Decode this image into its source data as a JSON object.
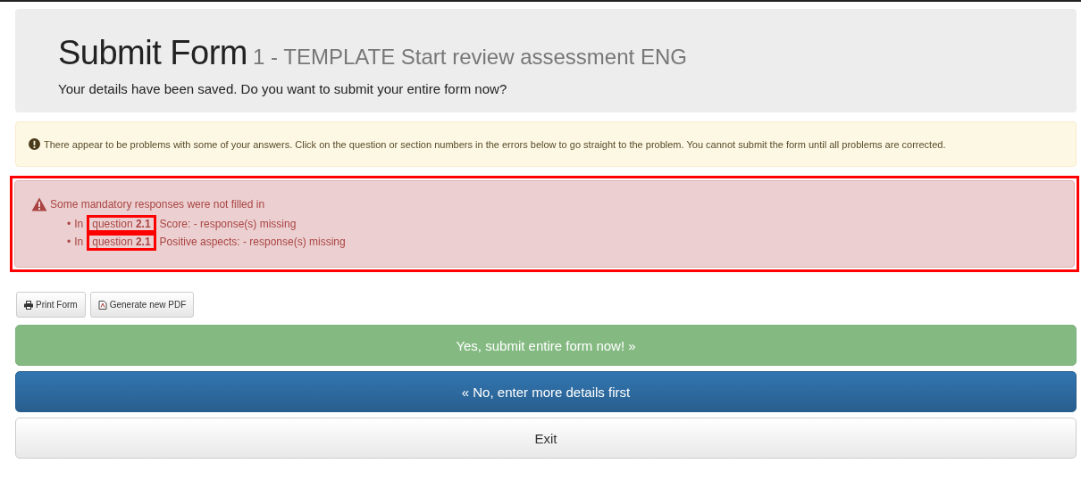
{
  "header": {
    "title": "Submit Form",
    "subtitle": "1 - TEMPLATE Start review assessment ENG",
    "message": "Your details have been saved. Do you want to submit your entire form now?"
  },
  "warning": {
    "text": "There appear to be problems with some of your answers. Click on the question or section numbers in the errors below to go straight to the problem. You cannot submit the form until all problems are corrected."
  },
  "errors": {
    "highlighted": true,
    "heading": "Some mandatory responses were not filled in",
    "items": [
      {
        "bullet": "•",
        "prefix": "In",
        "reference": "question **2.1**",
        "detail": "Score: - response(s) missing",
        "highlighted": true
      },
      {
        "bullet": "•",
        "prefix": "In",
        "reference": "question **2.1**",
        "detail": "Positive aspects: - response(s) missing",
        "highlighted": true
      }
    ]
  },
  "tools": [
    {
      "kind": "print",
      "label": "Print Form"
    },
    {
      "kind": "pdf",
      "label": "Generate new PDF"
    }
  ],
  "actions": [
    {
      "kind": "primary",
      "label": "Yes, submit entire form now! »"
    },
    {
      "kind": "secondary",
      "label": "« No, enter more details first"
    },
    {
      "kind": "plain",
      "label": "Exit"
    }
  ]
}
